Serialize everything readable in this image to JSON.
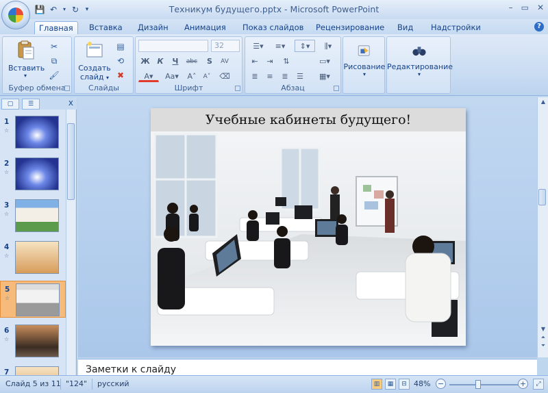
{
  "window": {
    "title": "Техникум будущего.pptx - Microsoft PowerPoint",
    "controls": [
      "–",
      "▭",
      "✕"
    ]
  },
  "quick_access": {
    "save_icon": "save-icon",
    "undo_icon": "undo-icon",
    "redo_icon": "redo-icon"
  },
  "tabs": [
    {
      "label": "Главная",
      "active": true
    },
    {
      "label": "Вставка"
    },
    {
      "label": "Дизайн"
    },
    {
      "label": "Анимация"
    },
    {
      "label": "Показ слайдов"
    },
    {
      "label": "Рецензирование"
    },
    {
      "label": "Вид"
    },
    {
      "label": "Надстройки"
    }
  ],
  "ribbon": {
    "clipboard": {
      "label": "Буфер обмена",
      "paste": "Вставить"
    },
    "slides": {
      "label": "Слайды",
      "new_slide_line1": "Создать",
      "new_slide_line2": "слайд"
    },
    "font": {
      "label": "Шрифт",
      "font_name": "",
      "font_size": "32",
      "bold": "Ж",
      "italic": "К",
      "underline": "Ч",
      "strike": "abc",
      "shadow": "S",
      "spacing": "AV",
      "aa": "Aa",
      "grow": "A",
      "shrink": "A"
    },
    "paragraph": {
      "label": "Абзац"
    },
    "drawing": {
      "label": "Рисование"
    },
    "editing": {
      "label": "Редактирование"
    }
  },
  "slide_panel": {
    "thumbnails": [
      {
        "num": "1",
        "selected": false,
        "theme": "blue"
      },
      {
        "num": "2",
        "selected": false,
        "theme": "blue"
      },
      {
        "num": "3",
        "selected": false,
        "theme": "building"
      },
      {
        "num": "4",
        "selected": false,
        "theme": "room"
      },
      {
        "num": "5",
        "selected": true,
        "theme": "class"
      },
      {
        "num": "6",
        "selected": false,
        "theme": "hall"
      },
      {
        "num": "7",
        "selected": false,
        "theme": "room"
      }
    ]
  },
  "slide": {
    "title": "Учебные кабинеты будущего!"
  },
  "notes": {
    "placeholder": "Заметки к слайду"
  },
  "status": {
    "slide_counter": "Слайд 5 из 11",
    "theme": "\"124\"",
    "language": "русский",
    "zoom": "48%",
    "zoom_level_fraction": 0.42
  },
  "colors": {
    "accent": "#15428b",
    "selected_thumb": "#f6ba7b"
  }
}
